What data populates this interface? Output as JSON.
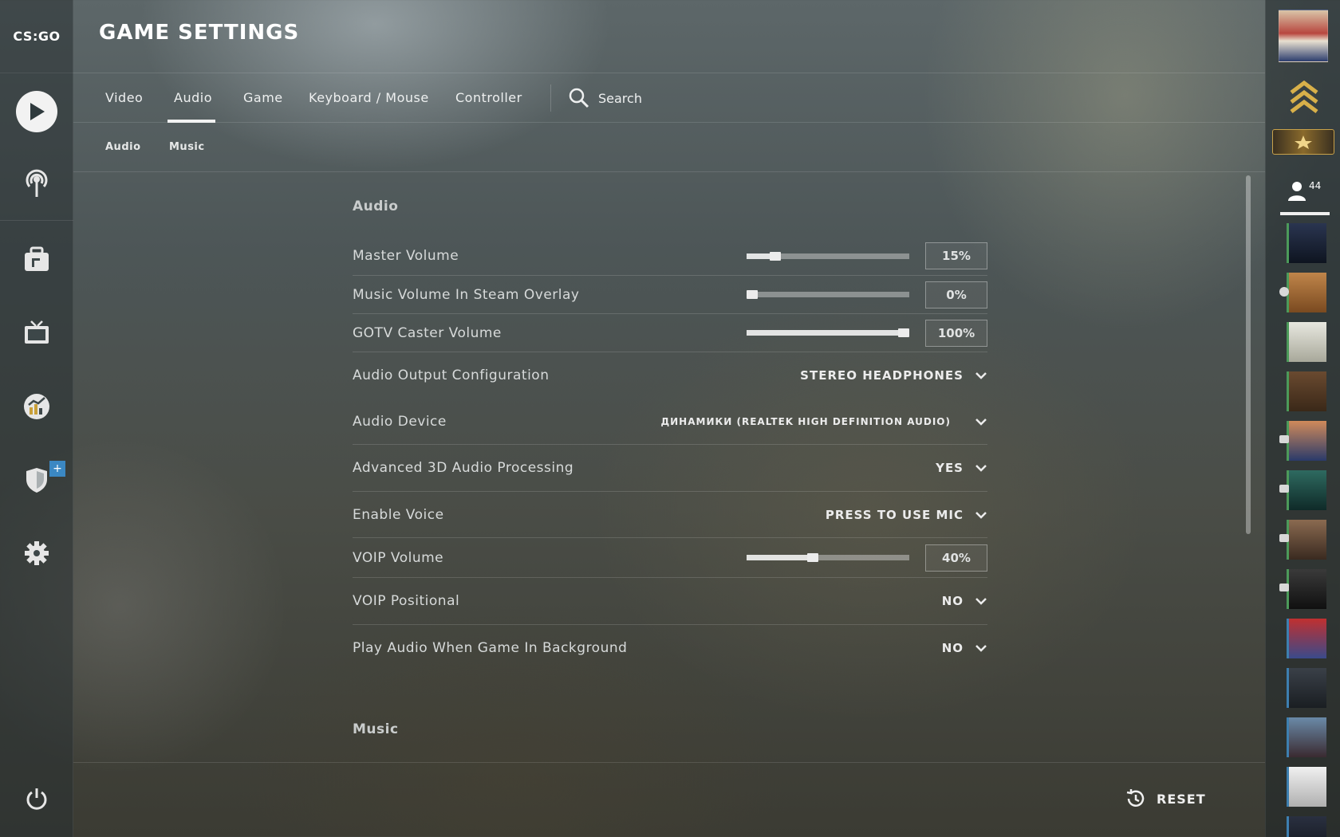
{
  "app": {
    "logo_text": "CS:GO"
  },
  "nav": {
    "items": [
      {
        "icon": "play-icon"
      },
      {
        "icon": "broadcast-icon"
      },
      {
        "icon": "inventory-icon"
      },
      {
        "icon": "tv-icon"
      },
      {
        "icon": "stats-icon"
      },
      {
        "icon": "shield-icon",
        "badge": "+"
      },
      {
        "icon": "gear-icon"
      },
      {
        "icon": "power-icon"
      }
    ]
  },
  "header": {
    "title": "GAME SETTINGS"
  },
  "tabs": [
    {
      "label": "Video",
      "active": false
    },
    {
      "label": "Audio",
      "active": true
    },
    {
      "label": "Game",
      "active": false
    },
    {
      "label": "Keyboard / Mouse",
      "active": false
    },
    {
      "label": "Controller",
      "active": false
    }
  ],
  "search": {
    "label": "Search"
  },
  "subtabs": [
    {
      "label": "Audio"
    },
    {
      "label": "Music"
    }
  ],
  "settings": {
    "audio_section_title": "Audio",
    "music_section_title": "Music",
    "rows": [
      {
        "label": "Master Volume",
        "type": "slider",
        "value": "15%",
        "fraction": 0.15
      },
      {
        "label": "Music Volume In Steam Overlay",
        "type": "slider",
        "value": "0%",
        "fraction": 0.0
      },
      {
        "label": "GOTV Caster Volume",
        "type": "slider",
        "value": "100%",
        "fraction": 1.0
      },
      {
        "label": "Audio Output Configuration",
        "type": "dropdown",
        "value": "STEREO HEADPHONES"
      },
      {
        "label": "Audio Device",
        "type": "dropdown",
        "value": "ДИНАМИКИ (REALTEK HIGH DEFINITION AUDIO)"
      },
      {
        "label": "Advanced 3D Audio Processing",
        "type": "dropdown",
        "value": "YES"
      },
      {
        "label": "Enable Voice",
        "type": "dropdown",
        "value": "PRESS TO USE MIC"
      },
      {
        "label": "VOIP Volume",
        "type": "slider",
        "value": "40%",
        "fraction": 0.4
      },
      {
        "label": "VOIP Positional",
        "type": "dropdown",
        "value": "NO"
      },
      {
        "label": "Play Audio When Game In Background",
        "type": "dropdown",
        "value": "NO"
      }
    ]
  },
  "footer": {
    "reset_label": "RESET"
  },
  "friends": {
    "count": "44"
  }
}
